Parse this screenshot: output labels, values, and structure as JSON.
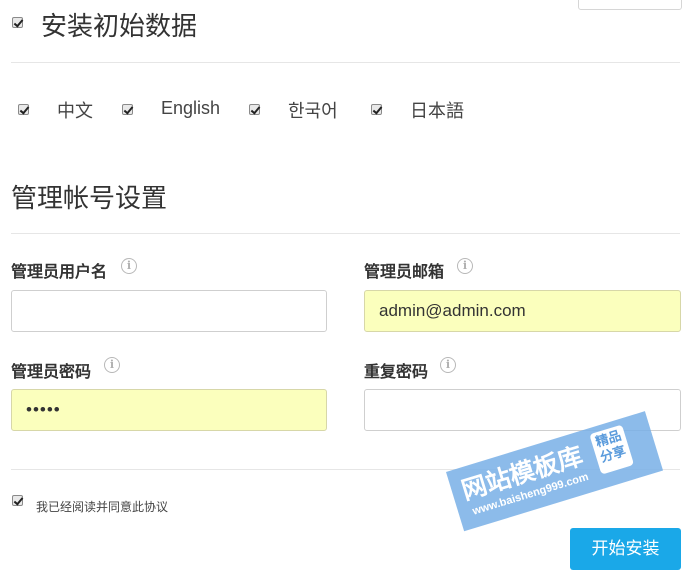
{
  "install": {
    "init_data_label": "安装初始数据",
    "languages": [
      "中文",
      "English",
      "한국어",
      "日本語"
    ]
  },
  "admin": {
    "section_title": "管理帐号设置",
    "username_label": "管理员用户名",
    "username_value": "",
    "email_label": "管理员邮箱",
    "email_value": "admin@admin.com",
    "password_label": "管理员密码",
    "password_value": "•••••",
    "repeat_label": "重复密码",
    "repeat_value": "",
    "info_glyph": "i"
  },
  "agreement": {
    "label": "我已经阅读并同意此协议"
  },
  "actions": {
    "start_install": "开始安装"
  },
  "watermark": {
    "title": "网站模板库",
    "url": "www.baisheng999.com",
    "badge": "精品分享"
  },
  "colors": {
    "accent": "#1aa8e8",
    "autofill": "#fbffbd",
    "watermark": "#78afe6"
  },
  "icons": {
    "checkbox": "checkmark-icon",
    "info": "info-icon"
  }
}
